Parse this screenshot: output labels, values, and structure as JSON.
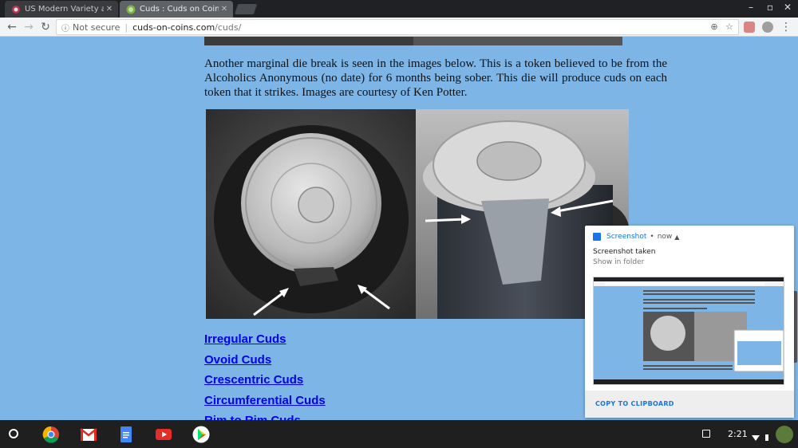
{
  "browser": {
    "tabs": [
      {
        "title": "US Modern Variety and E",
        "active": false
      },
      {
        "title": "Cuds : Cuds on Coins",
        "active": true
      }
    ],
    "address": {
      "security": "Not secure",
      "domain": "cuds-on-coins.com",
      "path": "/cuds/"
    }
  },
  "page": {
    "paragraph": "Another marginal die break is seen in the images below. This is a token believed to be from the Alcoholics Anonymous (no date) for 6 months being sober. This die will produce cuds on each token that it strikes. Images are courtesy of Ken Potter.",
    "links": [
      "Irregular Cuds",
      "Ovoid Cuds",
      "Crescentric Cuds",
      "Circumferential Cuds",
      "Rim to Rim Cuds"
    ]
  },
  "notification": {
    "app": "Screenshot",
    "separator": "•",
    "time": "now",
    "title": "Screenshot taken",
    "subtitle": "Show in folder",
    "action": "COPY TO CLIPBOARD"
  },
  "shelf": {
    "apps": [
      "chrome-icon",
      "gmail-icon",
      "docs-icon",
      "youtube-icon",
      "play-store-icon"
    ],
    "time": "2:21"
  },
  "colors": {
    "page_bg": "#7cb5e6",
    "link": "#0000ee",
    "accent": "#1a73e8",
    "shelf": "#1f1f1f"
  }
}
